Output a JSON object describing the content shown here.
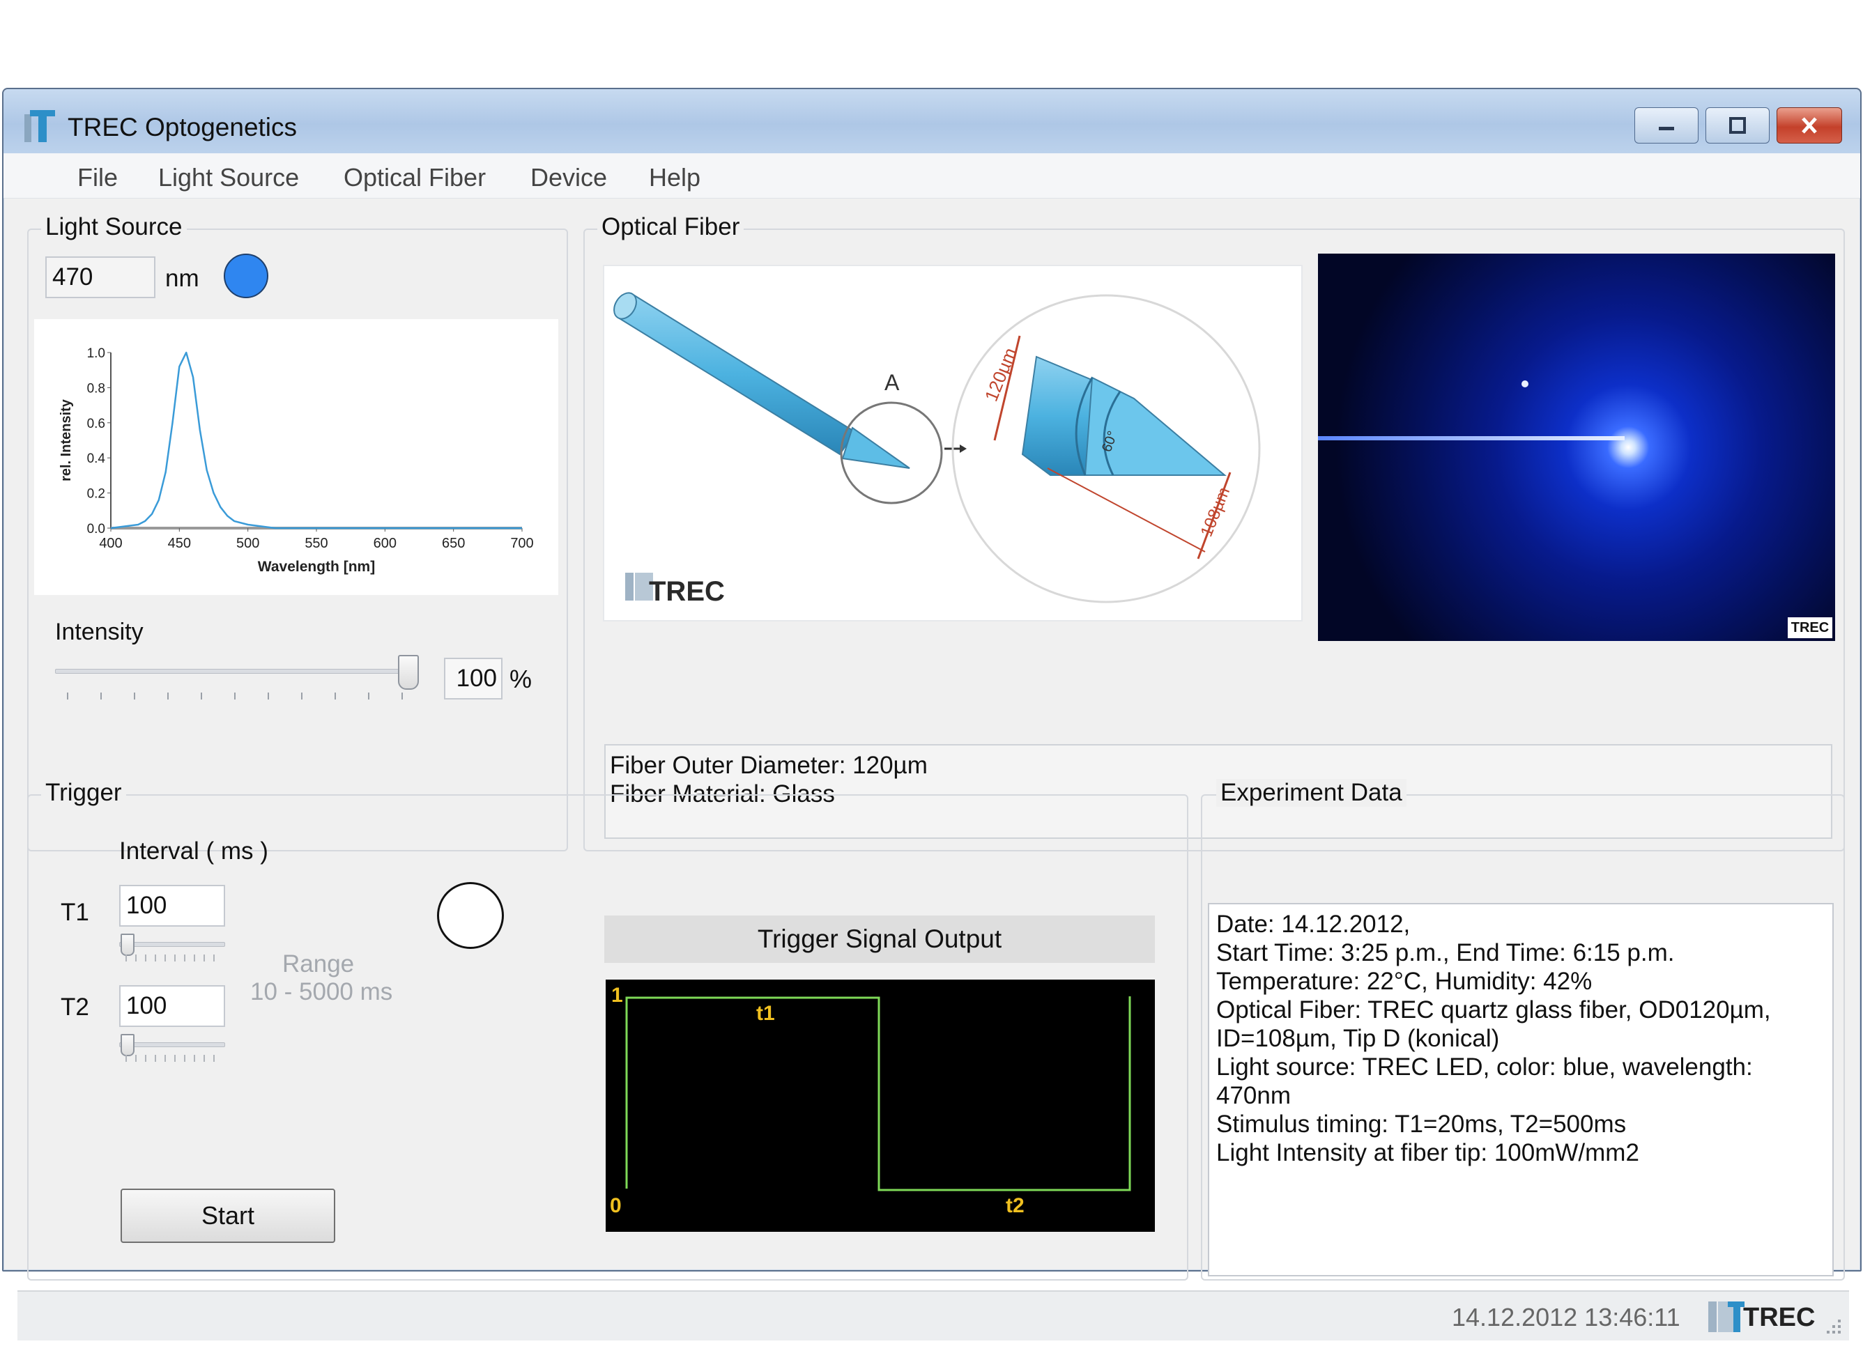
{
  "window": {
    "title": "TREC Optogenetics"
  },
  "menu": [
    "File",
    "Light Source",
    "Optical Fiber",
    "Device",
    "Help"
  ],
  "light_source": {
    "group_title": "Light Source",
    "wavelength_value": "470",
    "wavelength_unit": "nm",
    "indicator_color": "#2f86f0",
    "intensity_label": "Intensity",
    "intensity_value": "100",
    "intensity_unit": "%",
    "intensity_level": 1.0
  },
  "chart_data": {
    "type": "line",
    "xlabel": "Wavelength [nm]",
    "ylabel": "rel. Intensity",
    "xlim": [
      400,
      700
    ],
    "ylim": [
      0,
      1.0
    ],
    "xticks": [
      "400",
      "450",
      "500",
      "550",
      "600",
      "650",
      "700"
    ],
    "yticks": [
      "0.0",
      "0.2",
      "0.4",
      "0.6",
      "0.8",
      "1.0"
    ],
    "series": [
      {
        "color": "#3a9bd8",
        "x": [
          400,
          410,
          420,
          425,
          430,
          435,
          440,
          445,
          450,
          455,
          460,
          465,
          470,
          475,
          480,
          485,
          490,
          500,
          510,
          520,
          530,
          550,
          600,
          650,
          700
        ],
        "y": [
          0.0,
          0.01,
          0.02,
          0.04,
          0.08,
          0.16,
          0.32,
          0.6,
          0.92,
          1.0,
          0.86,
          0.56,
          0.33,
          0.2,
          0.12,
          0.07,
          0.04,
          0.02,
          0.01,
          0.0,
          0.0,
          0.0,
          0.0,
          0.0,
          0.0
        ]
      }
    ]
  },
  "optical_fiber": {
    "group_title": "Optical Fiber",
    "diagram_labels": {
      "detail": "A",
      "outer_diameter": "120µm",
      "angle": "60°",
      "inner_diameter": "108µm"
    },
    "logo_text": "TREC",
    "info": [
      "Fiber Outer Diameter: 120µm",
      "Fiber Material: Glass"
    ]
  },
  "trigger": {
    "group_title": "Trigger",
    "interval_label": "Interval ( ms )",
    "t1_label": "T1",
    "t1_value": "100",
    "t2_label": "T2",
    "t2_value": "100",
    "range_label": "Range",
    "range_value": "10 - 5000 ms",
    "start_label": "Start",
    "output_title": "Trigger Signal Output",
    "signal_high": "1",
    "signal_low": "0",
    "t1_marker": "t1",
    "t2_marker": "t2"
  },
  "experiment": {
    "group_title": "Experiment Data",
    "lines": [
      "Date: 14.12.2012,",
      "Start Time: 3:25 p.m., End Time: 6:15 p.m.",
      "Temperature: 22°C, Humidity: 42%",
      "Optical Fiber: TREC quartz glass fiber, OD0120µm,",
      "ID=108µm, Tip D (konical)",
      "Light source: TREC LED, color: blue, wavelength: 470nm",
      "Stimulus timing: T1=20ms, T2=500ms",
      "Light Intensity at fiber tip: 100mW/mm2"
    ]
  },
  "status": {
    "datetime": "14.12.2012 13:46:11",
    "logo_text": "TREC"
  }
}
